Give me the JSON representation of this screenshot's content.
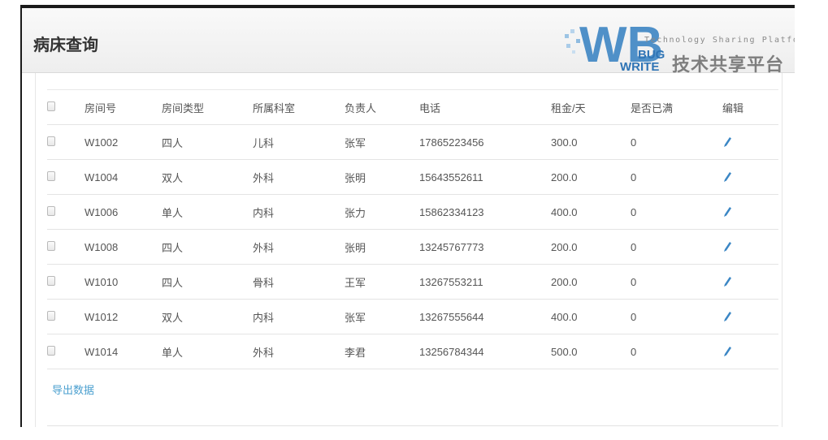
{
  "page": {
    "title": "病床查询"
  },
  "logo": {
    "letters_big": "WB",
    "letters_small_1": "BUG",
    "letters_small_2": "WRITE",
    "tagline": "Technology Sharing Platform",
    "cn_text": "技术共享平台"
  },
  "table": {
    "columns": [
      "房间号",
      "房间类型",
      "所属科室",
      "负责人",
      "电话",
      "租金/天",
      "是否已满",
      "编辑"
    ],
    "rows": [
      [
        "W1002",
        "四人",
        "儿科",
        "张军",
        "17865223456",
        "300.0",
        "0"
      ],
      [
        "W1004",
        "双人",
        "外科",
        "张明",
        "15643552611",
        "200.0",
        "0"
      ],
      [
        "W1006",
        "单人",
        "内科",
        "张力",
        "15862334123",
        "400.0",
        "0"
      ],
      [
        "W1008",
        "四人",
        "外科",
        "张明",
        "13245767773",
        "200.0",
        "0"
      ],
      [
        "W1010",
        "四人",
        "骨科",
        "王军",
        "13267553211",
        "200.0",
        "0"
      ],
      [
        "W1012",
        "双人",
        "内科",
        "张军",
        "13267555644",
        "400.0",
        "0"
      ],
      [
        "W1014",
        "单人",
        "外科",
        "李君",
        "13256784344",
        "500.0",
        "0"
      ]
    ]
  },
  "actions": {
    "export_label": "导出数据"
  },
  "icons": {
    "checkbox": "checkbox-icon",
    "edit": "pencil-icon"
  },
  "colors": {
    "link": "#4a9fcf",
    "edit_icon": "#3a86c4"
  }
}
